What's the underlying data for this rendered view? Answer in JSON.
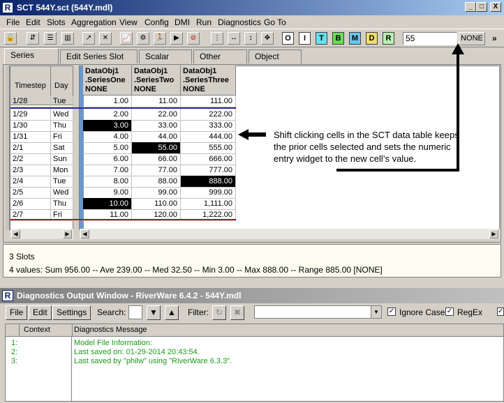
{
  "main_window": {
    "title": "SCT 544Y.sct (544Y.mdl)",
    "icon": "riverware-logo-icon",
    "controls": [
      "_",
      "□",
      "X"
    ]
  },
  "menu": [
    "File",
    "Edit",
    "Slots",
    "Aggregation",
    "View",
    "Config",
    "DMI",
    "Run",
    "Diagnostics",
    "Go To"
  ],
  "toolbar": {
    "letter_buttons": [
      {
        "label": "O",
        "color": "#ffffff"
      },
      {
        "label": "I",
        "color": "#ffffff"
      },
      {
        "label": "T",
        "color": "#66e0f0"
      },
      {
        "label": "B",
        "color": "#66dd55"
      },
      {
        "label": "M",
        "color": "#66c8f0"
      },
      {
        "label": "D",
        "color": "#f0e060"
      },
      {
        "label": "R",
        "color": "#b8f0b0"
      }
    ],
    "numeric_entry_value": "55",
    "flag_button": "NONE",
    "overflow": "»"
  },
  "tabs": [
    "Series Slots",
    "Edit Series Slot List",
    "Scalar Slots",
    "Other Slots",
    "Object Grid"
  ],
  "table": {
    "row_header_columns": [
      "Timestep",
      "Day"
    ],
    "columns": [
      {
        "object": "DataObj1",
        "slot": ".SeriesOne",
        "flag": "NONE"
      },
      {
        "object": "DataObj1",
        "slot": ".SeriesTwo",
        "flag": "NONE"
      },
      {
        "object": "DataObj1",
        "slot": ".SeriesThree",
        "flag": "NONE"
      }
    ],
    "initial_row": {
      "date": "1/28",
      "day": "Tue",
      "values": [
        "1.00",
        "11.00",
        "111.00"
      ]
    },
    "rows": [
      {
        "date": "1/29",
        "day": "Wed",
        "values": [
          "2.00",
          "22.00",
          "222.00"
        ]
      },
      {
        "date": "1/30",
        "day": "Thu",
        "values": [
          "3.00",
          "33.00",
          "333.00"
        ]
      },
      {
        "date": "1/31",
        "day": "Fri",
        "values": [
          "4.00",
          "44.00",
          "444.00"
        ]
      },
      {
        "date": "2/1",
        "day": "Sat",
        "values": [
          "5.00",
          "55.00",
          "555.00"
        ]
      },
      {
        "date": "2/2",
        "day": "Sun",
        "values": [
          "6.00",
          "66.00",
          "666.00"
        ]
      },
      {
        "date": "2/3",
        "day": "Mon",
        "values": [
          "7.00",
          "77.00",
          "777.00"
        ]
      },
      {
        "date": "2/4",
        "day": "Tue",
        "values": [
          "8.00",
          "88.00",
          "888.00"
        ]
      },
      {
        "date": "2/5",
        "day": "Wed",
        "values": [
          "9.00",
          "99.00",
          "999.00"
        ]
      },
      {
        "date": "2/6",
        "day": "Thu",
        "values": [
          "10.00",
          "110.00",
          "1,111.00"
        ]
      },
      {
        "date": "2/7",
        "day": "Fri",
        "values": [
          "11.00",
          "120.00",
          "1,222.00"
        ]
      }
    ],
    "selected_cells": [
      [
        1,
        0
      ],
      [
        3,
        1
      ],
      [
        6,
        2
      ],
      [
        8,
        0
      ]
    ]
  },
  "annotation": {
    "text": "Shift clicking cells in the SCT data table keeps the prior cells selected and sets the numeric entry widget to the new cell’s value."
  },
  "status": {
    "slots": "3 Slots",
    "summary": "4 values:  Sum 956.00 -- Ave 239.00 -- Med 32.50 -- Min 3.00 -- Max 888.00 -- Range 885.00 [NONE]"
  },
  "diagnostics": {
    "title": "Diagnostics Output Window - RiverWare 6.4.2 - 544Y.mdl",
    "buttons": [
      "File",
      "Edit",
      "Settings"
    ],
    "search_label": "Search:",
    "filter_label": "Filter:",
    "ignore_case": "Ignore Case",
    "regex": "RegEx",
    "columns": [
      "Context",
      "Diagnostics Message"
    ],
    "messages": [
      {
        "context": "1:",
        "text": "Model File Information:"
      },
      {
        "context": "2:",
        "text": "Last saved on: 01-29-2014 20:43:54."
      },
      {
        "context": "3:",
        "text": "Last saved by \"philw\" using \"RiverWare 6.3.3\"."
      }
    ],
    "message_color": "#1a9a1a"
  }
}
